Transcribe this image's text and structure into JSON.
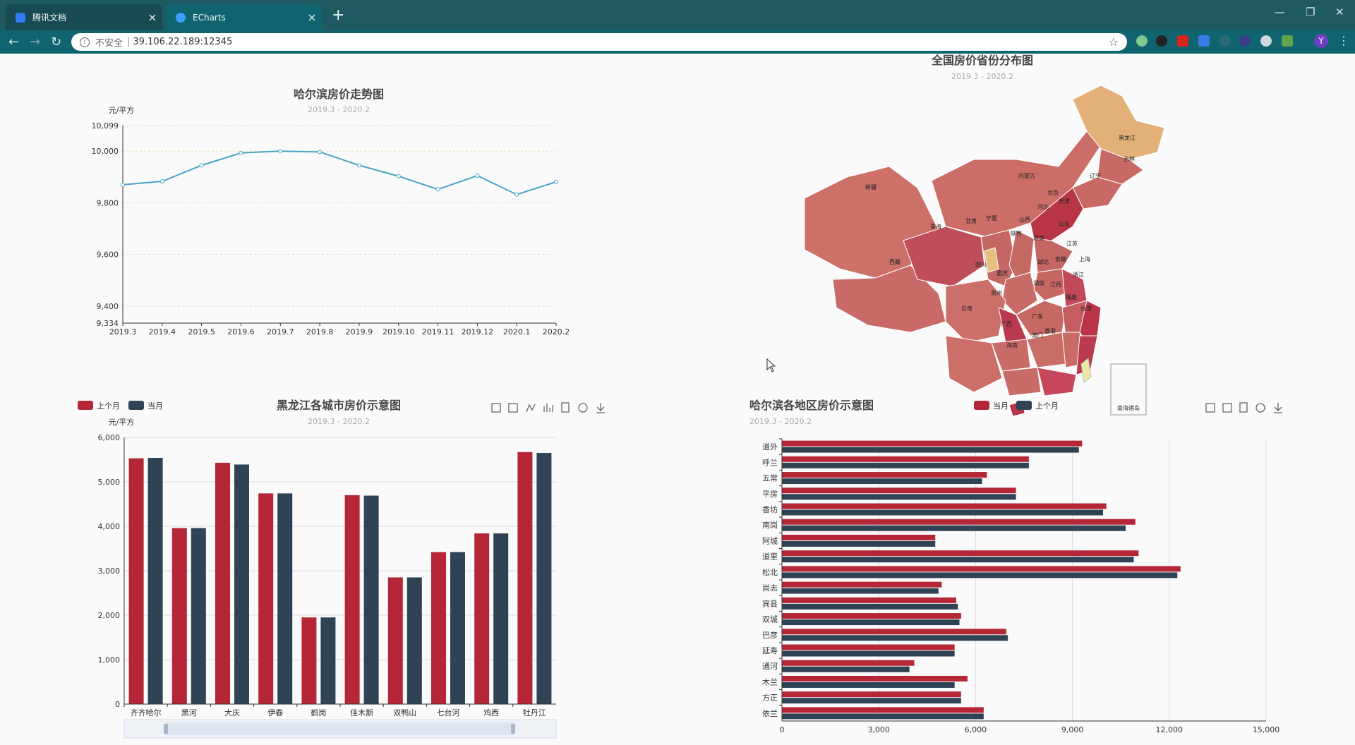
{
  "browser": {
    "tabs": [
      {
        "title": "腾讯文档",
        "active": false,
        "fav_color": "#2f7cf6"
      },
      {
        "title": "ECharts",
        "active": true,
        "fav_color": "#3aa0ff"
      }
    ],
    "close_glyph": "×",
    "new_tab_glyph": "+",
    "address": {
      "security": "不安全",
      "separator": "|",
      "url": "39.106.22.189:12345"
    },
    "profile_initial": "Y"
  },
  "charts": {
    "line": {
      "title": "哈尔滨房价走势图",
      "subtitle": "2019.3 - 2020.2",
      "unit": "元/平方",
      "color": "#4aa3c5"
    },
    "map": {
      "title": "全国房价省份分布图",
      "subtitle": "2019.3 - 2020.2",
      "inset_label": "南海诸岛",
      "provinces": [
        "黑龙江",
        "吉林",
        "辽宁",
        "内蒙古",
        "北京",
        "天津",
        "河北",
        "山西",
        "宁夏",
        "甘肃",
        "青海",
        "新疆",
        "西藏",
        "四川",
        "陕西",
        "河南",
        "山东",
        "江苏",
        "上海",
        "安徽",
        "湖北",
        "重庆",
        "湖南",
        "江西",
        "浙江",
        "福建",
        "贵州",
        "云南",
        "广西",
        "广东",
        "香港",
        "澳门",
        "海南",
        "台湾"
      ]
    },
    "hlj_bar": {
      "title": "黑龙江各城市房价示意图",
      "subtitle": "2019.3 - 2020.2",
      "unit": "元/平方",
      "legend": [
        "上个月",
        "当月"
      ]
    },
    "hrb_bar": {
      "title": "哈尔滨各地区房价示意图",
      "subtitle": "2019.3 - 2020.2",
      "legend": [
        "当月",
        "上个月"
      ]
    }
  },
  "colors": {
    "red": "#b52636",
    "navy": "#2f4355",
    "line": "#4aa3c5",
    "grid": "#d9dce6"
  },
  "chart_data": [
    {
      "type": "line",
      "title": "哈尔滨房价走势图",
      "ylabel": "元/平方",
      "x": [
        "2019.3",
        "2019.4",
        "2019.5",
        "2019.6",
        "2019.7",
        "2019.8",
        "2019.9",
        "2019.10",
        "2019.11",
        "2019.12",
        "2020.1",
        "2020.2"
      ],
      "values": [
        9870,
        9883,
        9945,
        9993,
        10000,
        9997,
        9945,
        9903,
        9852,
        9905,
        9832,
        9881
      ],
      "ylim": [
        9334,
        10099
      ],
      "yticks": [
        9334,
        9400,
        9600,
        9800,
        10000,
        10099
      ]
    },
    {
      "type": "bar",
      "title": "黑龙江各城市房价示意图",
      "ylabel": "元/平方",
      "categories": [
        "齐齐哈尔",
        "黑河",
        "大庆",
        "伊春",
        "鹤岗",
        "佳木斯",
        "双鸭山",
        "七台河",
        "鸡西",
        "牡丹江"
      ],
      "series": [
        {
          "name": "上个月",
          "values": [
            5530,
            3960,
            5430,
            4740,
            1950,
            4700,
            2850,
            3420,
            3840,
            5670
          ]
        },
        {
          "name": "当月",
          "values": [
            5540,
            3960,
            5390,
            4740,
            1950,
            4690,
            2850,
            3420,
            3840,
            5650
          ]
        }
      ],
      "ylim": [
        0,
        6000
      ],
      "yticks": [
        0,
        1000,
        2000,
        3000,
        4000,
        5000,
        6000
      ]
    },
    {
      "type": "bar",
      "title": "哈尔滨各地区房价示意图",
      "orientation": "horizontal",
      "categories": [
        "道外",
        "呼兰",
        "五常",
        "平房",
        "香坊",
        "南岗",
        "阿城",
        "道里",
        "松北",
        "尚志",
        "宾县",
        "双城",
        "巴彦",
        "延寿",
        "通河",
        "木兰",
        "方正",
        "依兰"
      ],
      "series": [
        {
          "name": "当月",
          "values": [
            9300,
            7650,
            6350,
            7250,
            10050,
            10950,
            4750,
            11050,
            12350,
            4950,
            5400,
            5550,
            6950,
            5350,
            4100,
            5750,
            5550,
            6250
          ]
        },
        {
          "name": "上个月",
          "values": [
            9200,
            7650,
            6200,
            7250,
            9950,
            10650,
            4750,
            10900,
            12250,
            4850,
            5450,
            5500,
            7000,
            5350,
            3950,
            5350,
            5550,
            6250
          ]
        }
      ],
      "xlim": [
        0,
        15000
      ],
      "xticks": [
        0,
        3000,
        6000,
        9000,
        12000,
        15000
      ]
    }
  ]
}
